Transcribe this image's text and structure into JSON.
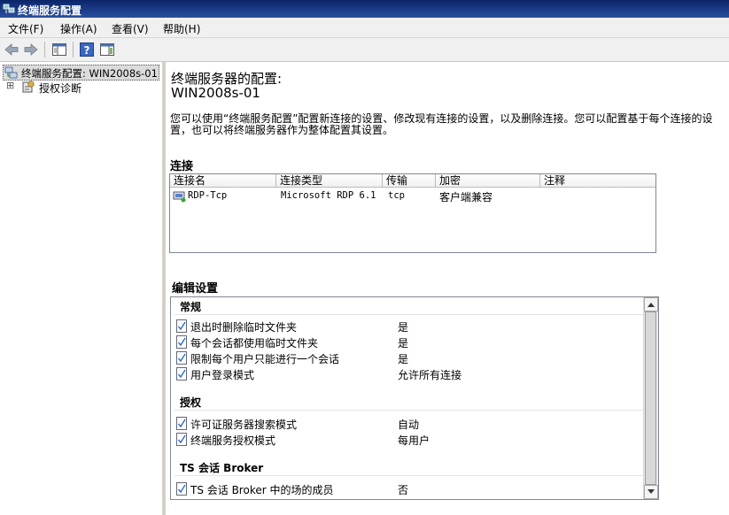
{
  "window": {
    "title": "终端服务配置"
  },
  "menu": {
    "items": [
      "文件(F)",
      "操作(A)",
      "查看(V)",
      "帮助(H)"
    ]
  },
  "tree": {
    "root_label": "终端服务配置: WIN2008s-01",
    "child_label": "授权诊断",
    "expander": "⊞"
  },
  "main": {
    "heading": "终端服务器的配置:",
    "server_name": "WIN2008s-01",
    "description": "您可以使用“终端服务配置”配置新连接的设置、修改现有连接的设置，以及删除连接。您可以配置基于每个连接的设置，也可以将终端服务器作为整体配置其设置。",
    "connections_title": "连接",
    "columns": [
      "连接名",
      "连接类型",
      "传输",
      "加密",
      "注释"
    ],
    "rows": [
      {
        "name": "RDP-Tcp",
        "type": "Microsoft RDP 6.1",
        "transport": "tcp",
        "encryption": "客户端兼容",
        "comment": ""
      }
    ],
    "edit_title": "编辑设置",
    "groups": [
      {
        "title": "常规",
        "settings": [
          {
            "label": "退出时删除临时文件夹",
            "value": "是"
          },
          {
            "label": "每个会话都使用临时文件夹",
            "value": "是"
          },
          {
            "label": "限制每个用户只能进行一个会话",
            "value": "是"
          },
          {
            "label": "用户登录模式",
            "value": "允许所有连接"
          }
        ]
      },
      {
        "title": "授权",
        "settings": [
          {
            "label": "许可证服务器搜索模式",
            "value": "自动"
          },
          {
            "label": "终端服务授权模式",
            "value": "每用户"
          }
        ]
      },
      {
        "title": "TS 会话 Broker",
        "settings": [
          {
            "label": "TS 会话 Broker 中的场的成员",
            "value": "否"
          }
        ]
      }
    ]
  },
  "colors": {
    "titlebar": "#0a246a",
    "panel": "#f0f0f0",
    "border": "#828790"
  }
}
